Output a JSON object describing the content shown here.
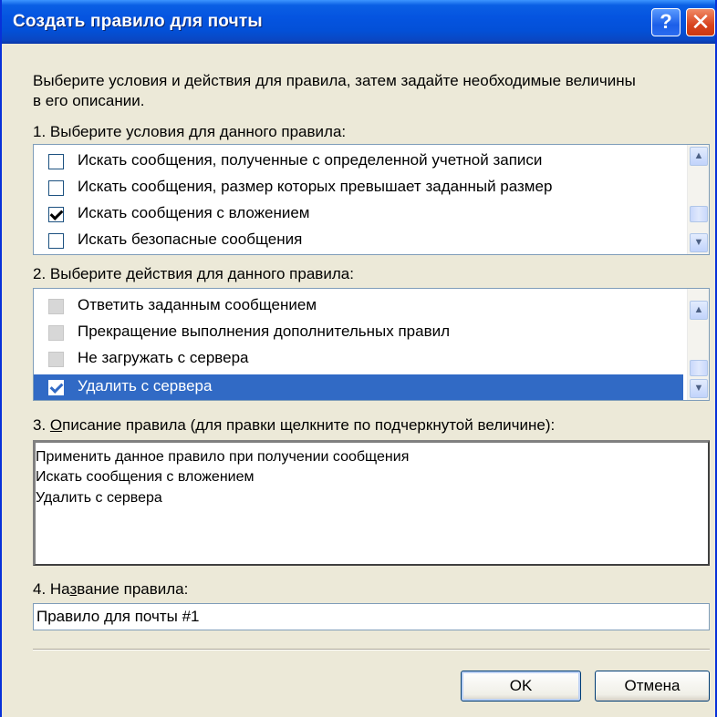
{
  "window": {
    "title": "Создать правило для почты",
    "help_glyph": "?",
    "close_glyph": "✕"
  },
  "intro": {
    "line1": "Выберите условия и действия для правила, затем задайте необходимые величины",
    "line2": "в его описании."
  },
  "conditions": {
    "label": "1. Выберите условия для данного правила:",
    "items": [
      {
        "label": "Искать сообщения, полученные с определенной учетной записи",
        "checked": false
      },
      {
        "label": "Искать сообщения, размер которых превышает заданный размер",
        "checked": false
      },
      {
        "label": "Искать сообщения с вложением",
        "checked": true
      },
      {
        "label": "Искать безопасные сообщения",
        "checked": false
      }
    ]
  },
  "actions": {
    "label": "2. Выберите действия для данного правила:",
    "items": [
      {
        "label": "Ответить заданным сообщением",
        "checked": false,
        "enabled": false
      },
      {
        "label": "Прекращение выполнения дополнительных правил",
        "checked": false,
        "enabled": false
      },
      {
        "label": "Не загружать с сервера",
        "checked": false,
        "enabled": false
      },
      {
        "label": "Удалить с сервера",
        "checked": true,
        "enabled": true,
        "selected": true
      }
    ]
  },
  "description": {
    "label_prefix": "3. ",
    "label_mnemonic": "О",
    "label_rest": "писание правила (для правки щелкните по подчеркнутой величине):",
    "lines": [
      "Применить данное правило при получении сообщения",
      "Искать сообщения с вложением",
      "Удалить с сервера"
    ]
  },
  "rule_name": {
    "label_prefix": "4. На",
    "label_mnemonic": "з",
    "label_rest": "вание правила:",
    "value": "Правило для почты #1"
  },
  "buttons": {
    "ok": "OK",
    "cancel": "Отмена"
  },
  "scroll": {
    "up_glyph": "▲",
    "down_glyph": "▼"
  }
}
